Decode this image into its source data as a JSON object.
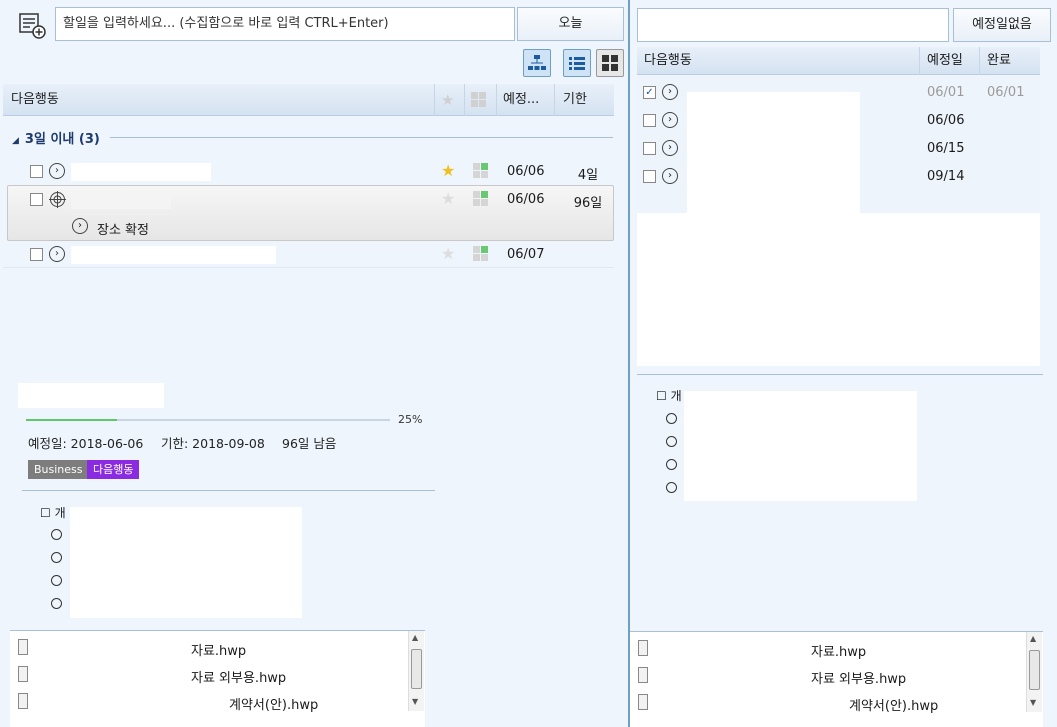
{
  "left": {
    "quick_input_placeholder": "할일을 입력하세요... (수집함으로 바로 입력 CTRL+Enter)",
    "today_button": "오늘",
    "columns": {
      "title": "다음행동",
      "due_date": "예정...",
      "deadline": "기한"
    },
    "group": {
      "label": "3일 이내 (3)"
    },
    "tasks": [
      {
        "date": "06/06",
        "deadline": "4일",
        "starred": true
      },
      {
        "date": "06/06",
        "deadline": "96일",
        "starred": false
      },
      {
        "date": "06/07",
        "deadline": "",
        "starred": false
      }
    ],
    "subtask_label": "장소 확정",
    "detail": {
      "progress_percent": 25,
      "progress_label": "25%",
      "planned": "예정일: 2018-06-06",
      "deadline": "기한: 2018-09-08",
      "remaining": "96일 남음",
      "tags": [
        "Business",
        "다음행동"
      ],
      "checklist_header": "☐ 개"
    },
    "files": [
      {
        "name": "자료.hwp"
      },
      {
        "name": "자료 외부용.hwp"
      },
      {
        "name": "계약서(안).hwp"
      }
    ]
  },
  "right": {
    "no_due_button": "예정일없음",
    "columns": {
      "title": "다음행동",
      "due_date": "예정일",
      "done": "완료"
    },
    "rows": [
      {
        "date": "06/01",
        "done": "06/01",
        "checked": true
      },
      {
        "date": "06/06",
        "done": "",
        "checked": false
      },
      {
        "date": "06/15",
        "done": "",
        "checked": false
      },
      {
        "date": "09/14",
        "done": "",
        "checked": false
      }
    ],
    "checklist_header": "☐ 개",
    "files": [
      {
        "name": "자료.hwp"
      },
      {
        "name": "자료 외부용.hwp"
      },
      {
        "name": "계약서(안).hwp"
      }
    ]
  },
  "colors": {
    "accent": "#1f3a6e",
    "progress": "#5ec86a",
    "tag_business": "#7d7d7d",
    "tag_next": "#8a2be2",
    "star": "#f0c020"
  },
  "icons": {
    "add_task": "add-task-icon",
    "tree_view": "tree-view-icon",
    "list_view": "list-view-icon",
    "grid_view": "grid-view-icon"
  }
}
